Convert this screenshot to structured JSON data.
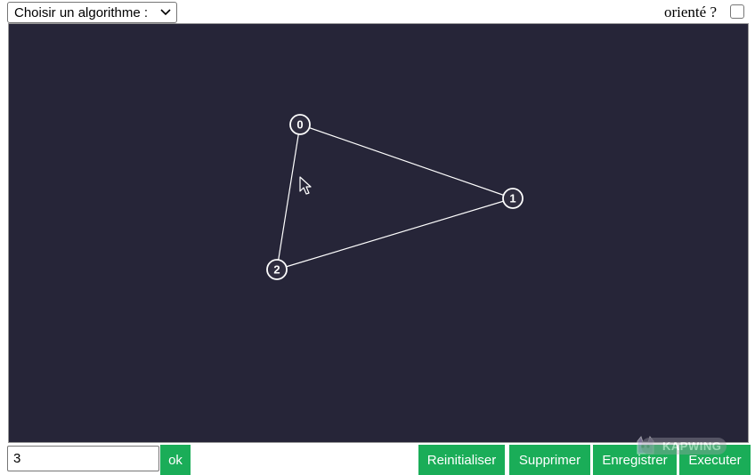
{
  "toolbar": {
    "algorithm_select": "Choisir un algorithme :",
    "oriented_label": "orienté ?",
    "oriented_checked": false
  },
  "graph": {
    "nodes": [
      {
        "id": "0",
        "label": "0"
      },
      {
        "id": "1",
        "label": "1"
      },
      {
        "id": "2",
        "label": "2"
      }
    ],
    "edges": [
      {
        "from": "0",
        "to": "1"
      },
      {
        "from": "1",
        "to": "2"
      },
      {
        "from": "2",
        "to": "0"
      }
    ],
    "colors": {
      "background": "#262538",
      "stroke": "#ffffff",
      "node_fill": "#2f2d3f"
    }
  },
  "bottom": {
    "count_value": "3",
    "ok_label": "ok",
    "reset_label": "Reinitialiser",
    "delete_label": "Supprimer",
    "save_label": "Enregistrer",
    "run_label": "Executer",
    "button_color": "#1aad58"
  },
  "watermark": {
    "text": "KAPWING"
  }
}
